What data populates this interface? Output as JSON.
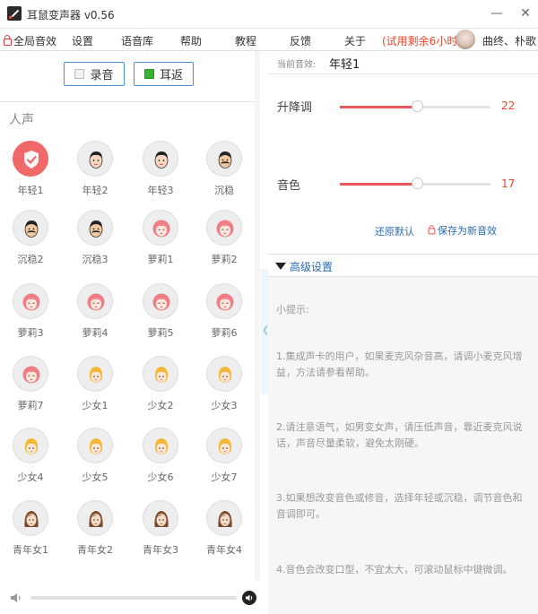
{
  "window": {
    "title": "耳鼠变声器 v0.56",
    "min_icon": "minimize-icon",
    "close_icon": "close-icon"
  },
  "menu": {
    "global_effects": "全局音效",
    "items": [
      "设置",
      "语音库",
      "帮助",
      "教程",
      "反馈",
      "关于"
    ],
    "trial": "(试用剩余6小时)",
    "user": "曲终、朴歌"
  },
  "toolbar": {
    "record": "录音",
    "monitor": "耳返"
  },
  "category": "人声",
  "voices": [
    {
      "name": "年轻1",
      "icon": "shield-check-icon",
      "selected": true
    },
    {
      "name": "年轻2",
      "icon": "young-man-icon"
    },
    {
      "name": "年轻3",
      "icon": "young-man-icon"
    },
    {
      "name": "沉稳",
      "icon": "mustache-man-icon"
    },
    {
      "name": "沉稳2",
      "icon": "mustache-man-icon"
    },
    {
      "name": "沉稳3",
      "icon": "mustache-man-icon"
    },
    {
      "name": "萝莉1",
      "icon": "loli-girl-icon"
    },
    {
      "name": "萝莉2",
      "icon": "loli-girl-icon"
    },
    {
      "name": "萝莉3",
      "icon": "loli-girl-icon"
    },
    {
      "name": "萝莉4",
      "icon": "loli-girl-icon"
    },
    {
      "name": "萝莉5",
      "icon": "loli-girl-icon"
    },
    {
      "name": "萝莉6",
      "icon": "loli-girl-icon"
    },
    {
      "name": "萝莉7",
      "icon": "loli-girl-icon"
    },
    {
      "name": "少女1",
      "icon": "blonde-girl-icon"
    },
    {
      "name": "少女2",
      "icon": "blonde-girl-icon"
    },
    {
      "name": "少女3",
      "icon": "blonde-girl-icon"
    },
    {
      "name": "少女4",
      "icon": "blonde-girl-icon"
    },
    {
      "name": "少女5",
      "icon": "blonde-girl-icon"
    },
    {
      "name": "少女6",
      "icon": "blonde-girl-icon"
    },
    {
      "name": "少女7",
      "icon": "blonde-girl-icon"
    },
    {
      "name": "青年女1",
      "icon": "brunette-woman-icon"
    },
    {
      "name": "青年女2",
      "icon": "brunette-woman-icon"
    },
    {
      "name": "青年女3",
      "icon": "brunette-woman-icon"
    },
    {
      "name": "青年女4",
      "icon": "brunette-woman-icon"
    }
  ],
  "current": {
    "label": "当前音效:",
    "value": "年轻1"
  },
  "sliders": {
    "pitch": {
      "label": "升降调",
      "value": "22",
      "fraction": 0.51
    },
    "timbre": {
      "label": "音色",
      "value": "17",
      "fraction": 0.51
    }
  },
  "actions": {
    "reset": "还原默认",
    "save": "保存为新音效"
  },
  "advanced": {
    "label": "高级设置"
  },
  "tips": {
    "title": "小提示:",
    "t1": "1.集成声卡的用户，如果麦克风杂音高，请调小麦克风增益，方法请参看帮助。",
    "t2": "2.请注意语气，如男变女声，请压低声音，靠近麦克风说话，声音尽量柔软，避免太刚硬。",
    "t3": "3.如果想改变音色或修音，选择年轻或沉稳，调节音色和音调即可。",
    "t4": "4.音色会改变口型，不宜太大，可滚动鼠标中键微调。"
  },
  "colors": {
    "accent": "#e8575a",
    "link": "#2a6ab4",
    "trial": "#e8452c",
    "check_on": "#34b531"
  }
}
